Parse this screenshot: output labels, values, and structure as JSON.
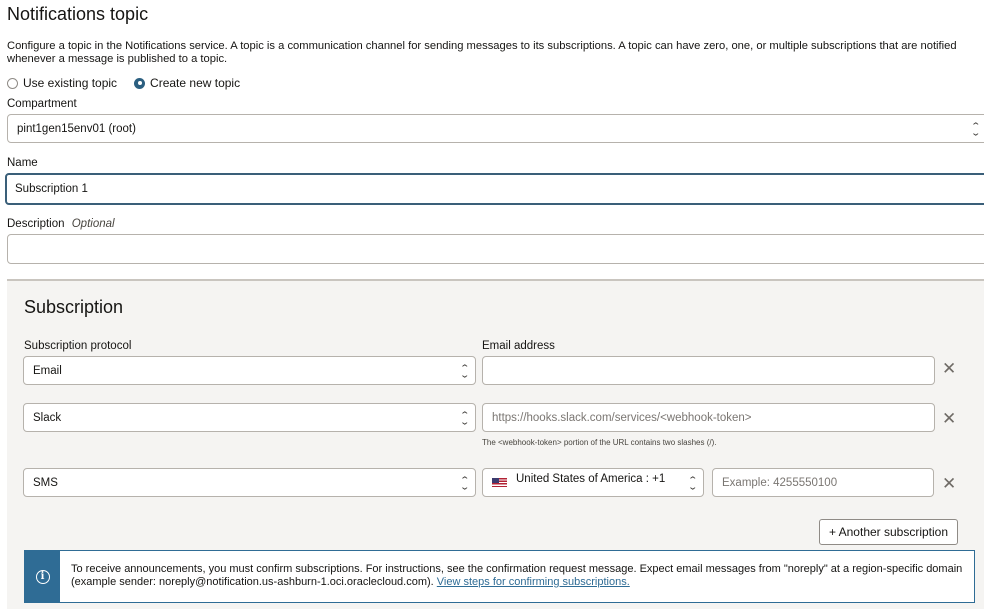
{
  "section": {
    "title": "Notifications topic",
    "description": "Configure a topic in the Notifications service. A topic is a communication channel for sending messages to its subscriptions. A topic can have zero, one, or multiple subscriptions that are notified whenever a message is published to a topic."
  },
  "topic_mode": {
    "options": [
      "Use existing topic",
      "Create new topic"
    ],
    "selected": "Create new topic"
  },
  "compartment": {
    "label": "Compartment",
    "value": "pint1gen15env01 (root)"
  },
  "name": {
    "label": "Name",
    "value": "Subscription 1"
  },
  "description": {
    "label": "Description",
    "optional": "Optional",
    "value": ""
  },
  "subscription": {
    "heading": "Subscription",
    "protocol_label": "Subscription protocol",
    "email_label": "Email address",
    "rows": [
      {
        "protocol": "Email",
        "value": "",
        "placeholder": ""
      },
      {
        "protocol": "Slack",
        "value": "",
        "placeholder": "https://hooks.slack.com/services/<webhook-token>",
        "hint": "The <webhook-token> portion of the URL contains two slashes (/)."
      },
      {
        "protocol": "SMS",
        "country": "United States of America : +1",
        "value": "",
        "placeholder": "Example: 4255550100"
      }
    ],
    "add_button": "+ Another subscription"
  },
  "info": {
    "text": "To receive announcements, you must confirm subscriptions. For instructions, see the confirmation request message. Expect email messages from \"noreply\" at a region-specific domain (example sender: noreply@notification.us-ashburn-1.oci.oraclecloud.com). ",
    "link": "View steps for confirming subscriptions."
  },
  "icons": {
    "close": "close-icon",
    "chevron": "chevron-up-down-icon",
    "info": "info-icon",
    "flag": "us-flag-icon"
  },
  "colors": {
    "accent": "#2f6c95",
    "radio_selected": "#2b5f80",
    "panel_bg": "#f5f4f2"
  }
}
